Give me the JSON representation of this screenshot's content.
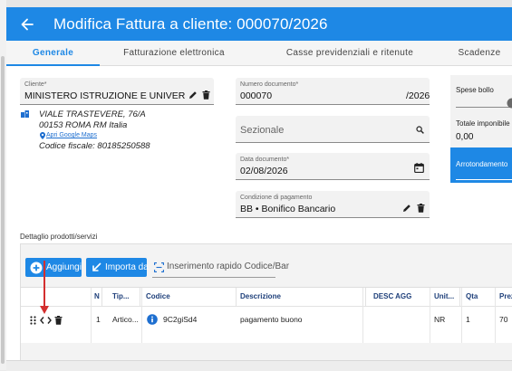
{
  "header": {
    "title": "Modifica Fattura a cliente: 000070/2026",
    "back_icon": "arrow-left-icon"
  },
  "tabs": [
    {
      "label": "Generale",
      "active": true
    },
    {
      "label": "Fatturazione elettronica",
      "active": false
    },
    {
      "label": "Casse previdenziali e ritenute",
      "active": false
    },
    {
      "label": "Scadenze",
      "active": false
    }
  ],
  "customer": {
    "label": "Cliente*",
    "value": "MINISTERO  ISTRUZIONE E UNIVERSITA' E RI",
    "address_line1": "VIALE TRASTEVERE, 76/A",
    "address_line2": "00153 ROMA RM Italia",
    "maps_link": "Apri Google Maps",
    "fiscal_code": "Codice fiscale: 80185250588"
  },
  "document": {
    "number_label": "Numero documento*",
    "number_value": "000070",
    "number_suffix": "/2026",
    "sectional_placeholder": "Sezionale",
    "date_label": "Data documento*",
    "date_value": "02/08/2026",
    "payment_label": "Condizione di pagamento",
    "payment_value": "BB • Bonifico Bancario"
  },
  "summary": {
    "stamp_label": "Spese bollo",
    "taxable_label": "Totale imponibile",
    "taxable_value": "0,00",
    "rounding_label": "Arrotondamento"
  },
  "products": {
    "section_title": "Dettaglio prodotti/servizi",
    "add_button": "Aggiungi",
    "import_button": "Importa da",
    "quick_insert_placeholder": "Inserimento rapido Codice/Bar",
    "columns": [
      "N",
      "Tip...",
      "Codice",
      "Descrizione",
      "DESC AGG",
      "Unit...",
      "Qta",
      "Prez"
    ],
    "rows": [
      {
        "n": "1",
        "tipo": "Artico...",
        "codice": "9C2giSd4",
        "descrizione": "pagamento buono",
        "desc_agg": "",
        "unita": "NR",
        "qta": "1",
        "prezzo": "70"
      }
    ]
  },
  "colors": {
    "accent": "#1e88e5",
    "annotation_arrow": "#d32f2f"
  }
}
